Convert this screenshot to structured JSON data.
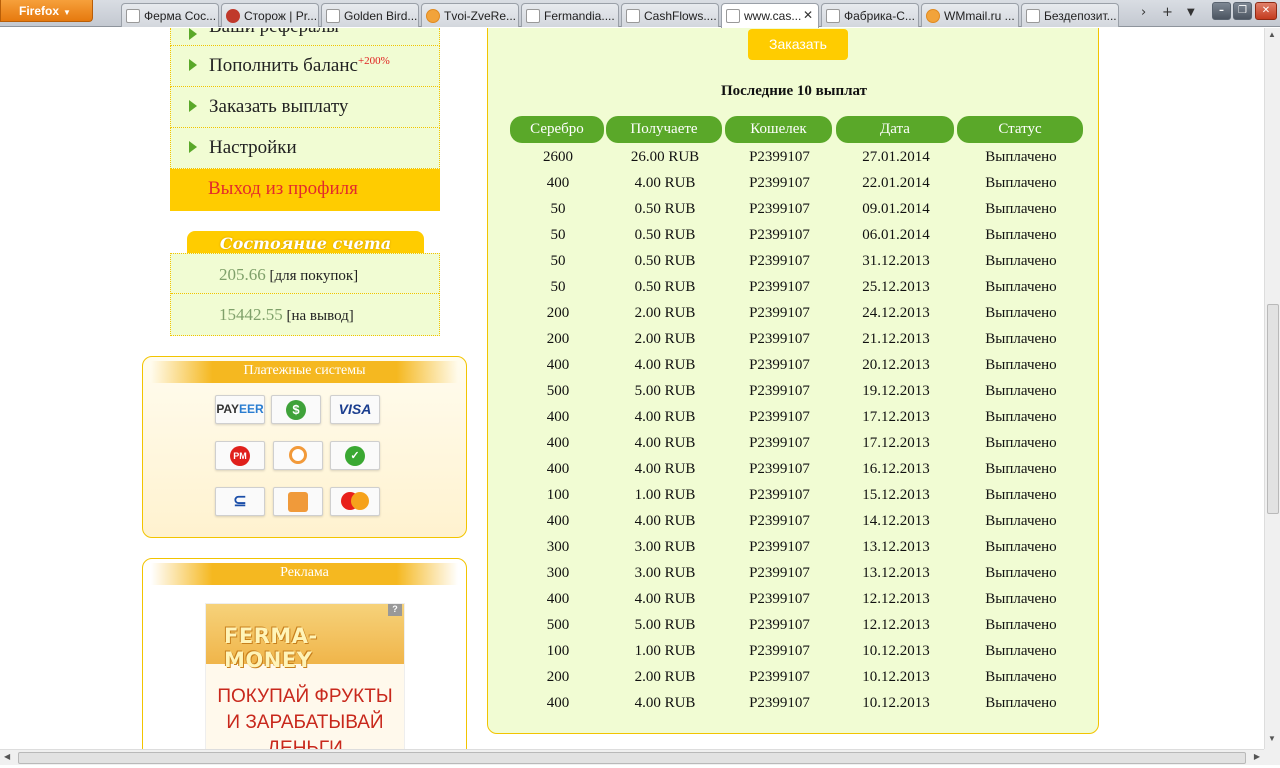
{
  "browser": {
    "menu_label": "Firefox",
    "tabs": [
      {
        "label": "Ферма Сос...",
        "icon": "page"
      },
      {
        "label": "Сторож | Pr...",
        "icon": "pinterest"
      },
      {
        "label": "Golden Bird...",
        "icon": "page"
      },
      {
        "label": "Tvoi-ZveRe...",
        "icon": "site"
      },
      {
        "label": "Fermandia....",
        "icon": "page"
      },
      {
        "label": "CashFlows....",
        "icon": "page"
      },
      {
        "label": "www.cas...",
        "icon": "page",
        "active": true
      },
      {
        "label": "Фабрика-С...",
        "icon": "page"
      },
      {
        "label": "WMmail.ru ...",
        "icon": "wmmail"
      },
      {
        "label": "Бездепозит...",
        "icon": "page"
      }
    ]
  },
  "menu": {
    "items": [
      {
        "label": "Ваши рефералы"
      },
      {
        "label": "Пополнить баланс",
        "badge": "+200%"
      },
      {
        "label": "Заказать выплату"
      },
      {
        "label": "Настройки"
      }
    ],
    "logout": "Выход из профиля"
  },
  "account": {
    "title": "Состояние счета",
    "purchase_amount": "205.66",
    "purchase_label": "[для покупок]",
    "withdraw_amount": "15442.55",
    "withdraw_label": "[на вывод]"
  },
  "payments": {
    "title": "Платежные системы",
    "systems": [
      "Payeer",
      "OKPay",
      "Visa",
      "Perfect Money",
      "QIWI",
      "Сбербанк",
      "Единый кошелек",
      "Яндекс.Деньги",
      "MasterCard"
    ]
  },
  "ads": {
    "title": "Реклама",
    "banner_logo": "FERMA-MONEY",
    "banner_line1": "ПОКУПАЙ ФРУКТЫ",
    "banner_line2": "И ЗАРАБАТЫВАЙ",
    "banner_line3": "ДЕНЬГИ"
  },
  "main": {
    "order_button": "Заказать",
    "payouts_title": "Последние 10 выплат",
    "columns": [
      "Серебро",
      "Получаете",
      "Кошелек",
      "Дата",
      "Статус"
    ],
    "rows": [
      [
        "2600",
        "26.00 RUB",
        "P2399107",
        "27.01.2014",
        "Выплачено"
      ],
      [
        "400",
        "4.00 RUB",
        "P2399107",
        "22.01.2014",
        "Выплачено"
      ],
      [
        "50",
        "0.50 RUB",
        "P2399107",
        "09.01.2014",
        "Выплачено"
      ],
      [
        "50",
        "0.50 RUB",
        "P2399107",
        "06.01.2014",
        "Выплачено"
      ],
      [
        "50",
        "0.50 RUB",
        "P2399107",
        "31.12.2013",
        "Выплачено"
      ],
      [
        "50",
        "0.50 RUB",
        "P2399107",
        "25.12.2013",
        "Выплачено"
      ],
      [
        "200",
        "2.00 RUB",
        "P2399107",
        "24.12.2013",
        "Выплачено"
      ],
      [
        "200",
        "2.00 RUB",
        "P2399107",
        "21.12.2013",
        "Выплачено"
      ],
      [
        "400",
        "4.00 RUB",
        "P2399107",
        "20.12.2013",
        "Выплачено"
      ],
      [
        "500",
        "5.00 RUB",
        "P2399107",
        "19.12.2013",
        "Выплачено"
      ],
      [
        "400",
        "4.00 RUB",
        "P2399107",
        "17.12.2013",
        "Выплачено"
      ],
      [
        "400",
        "4.00 RUB",
        "P2399107",
        "17.12.2013",
        "Выплачено"
      ],
      [
        "400",
        "4.00 RUB",
        "P2399107",
        "16.12.2013",
        "Выплачено"
      ],
      [
        "100",
        "1.00 RUB",
        "P2399107",
        "15.12.2013",
        "Выплачено"
      ],
      [
        "400",
        "4.00 RUB",
        "P2399107",
        "14.12.2013",
        "Выплачено"
      ],
      [
        "300",
        "3.00 RUB",
        "P2399107",
        "13.12.2013",
        "Выплачено"
      ],
      [
        "300",
        "3.00 RUB",
        "P2399107",
        "13.12.2013",
        "Выплачено"
      ],
      [
        "400",
        "4.00 RUB",
        "P2399107",
        "12.12.2013",
        "Выплачено"
      ],
      [
        "500",
        "5.00 RUB",
        "P2399107",
        "12.12.2013",
        "Выплачено"
      ],
      [
        "100",
        "1.00 RUB",
        "P2399107",
        "10.12.2013",
        "Выплачено"
      ],
      [
        "200",
        "2.00 RUB",
        "P2399107",
        "10.12.2013",
        "Выплачено"
      ],
      [
        "400",
        "4.00 RUB",
        "P2399107",
        "10.12.2013",
        "Выплачено"
      ]
    ]
  },
  "colors": {
    "accent_green": "#5aa829",
    "accent_yellow": "#ffcc00",
    "panel_bg": "#f1fcd3",
    "logout_text": "#e32b2b"
  }
}
